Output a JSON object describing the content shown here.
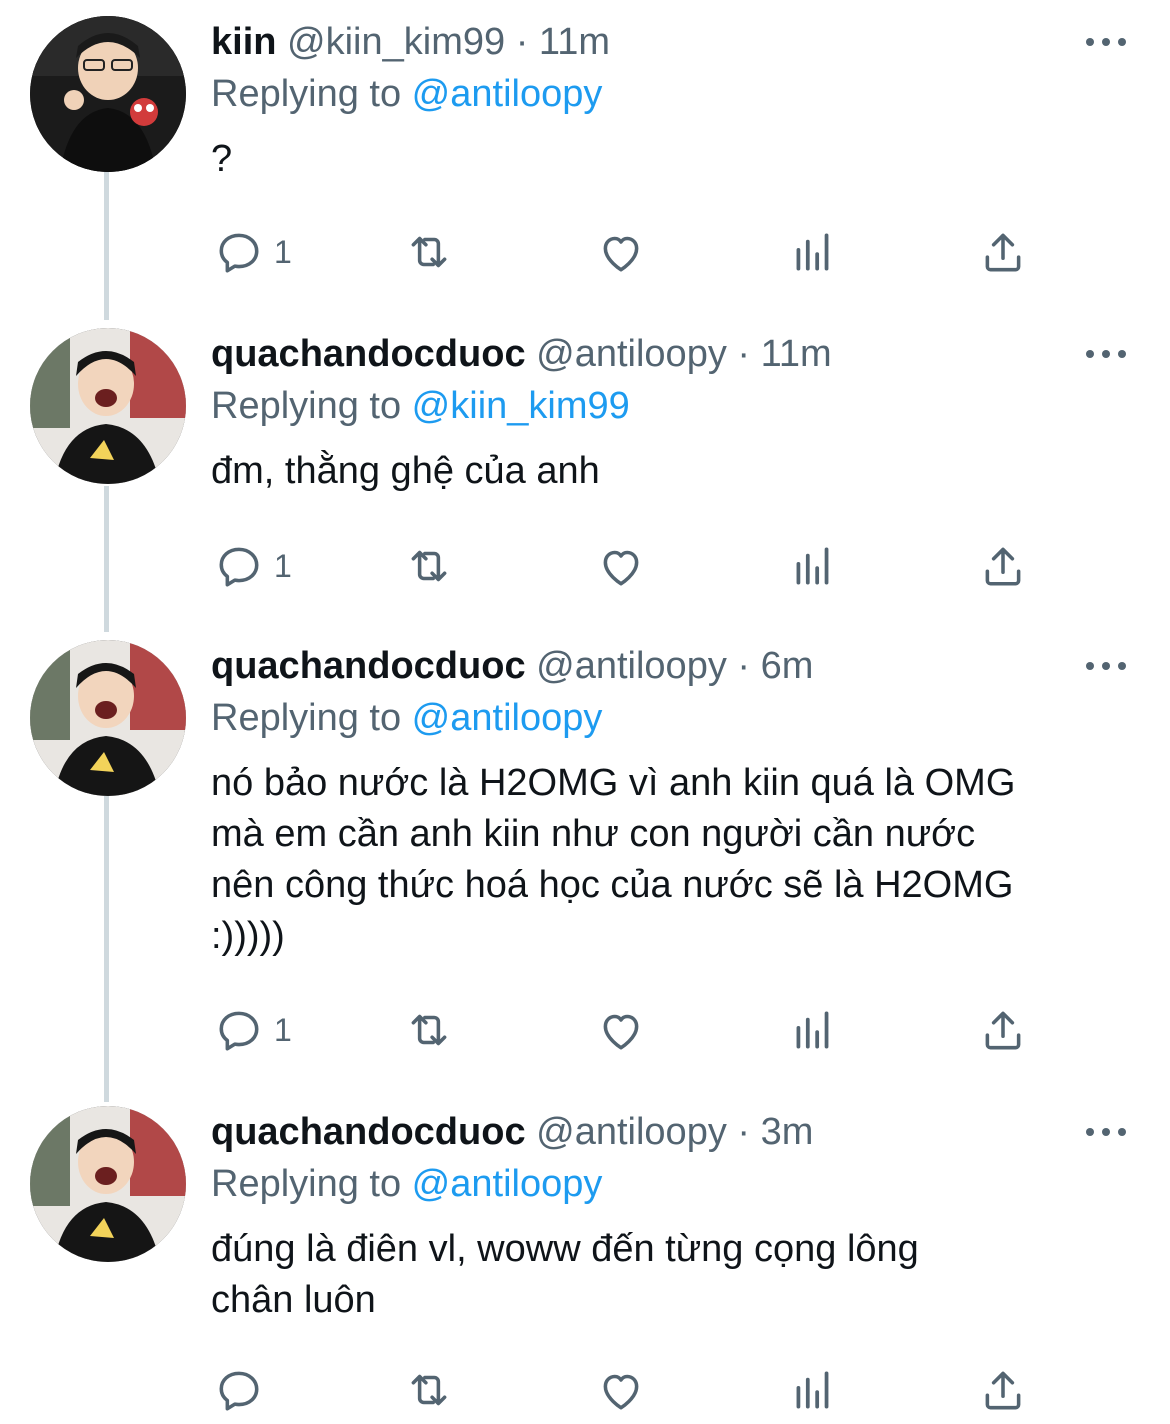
{
  "tweets": [
    {
      "name": "kiin",
      "handle": "@kiin_kim99",
      "separator": "·",
      "time": "11m",
      "replying_prefix": "Replying to ",
      "replying_to": "@antiloopy",
      "text": "?",
      "reply_count": "1"
    },
    {
      "name": "quachandocduoc",
      "handle": "@antiloopy",
      "separator": "·",
      "time": "11m",
      "replying_prefix": "Replying to ",
      "replying_to": "@kiin_kim99",
      "text": "đm, thằng ghệ của anh",
      "reply_count": "1"
    },
    {
      "name": "quachandocduoc",
      "handle": "@antiloopy",
      "separator": "·",
      "time": "6m",
      "replying_prefix": "Replying to ",
      "replying_to": "@antiloopy",
      "text": "nó bảo nước là H2OMG vì anh kiin quá là OMG\nmà em cần anh kiin như con người cần nước\nnên công thức hoá học của nước sẽ là H2OMG\n:)))))",
      "reply_count": "1"
    },
    {
      "name": "quachandocduoc",
      "handle": "@antiloopy",
      "separator": "·",
      "time": "3m",
      "replying_prefix": "Replying to ",
      "replying_to": "@antiloopy",
      "text": "đúng là điên vl, woww đến từng cọng lông\nchân luôn",
      "reply_count": ""
    }
  ],
  "icons": {
    "reply": "reply-icon",
    "retweet": "retweet-icon",
    "like": "like-icon",
    "views": "views-icon",
    "share": "share-icon",
    "more": "more-icon"
  },
  "colors": {
    "text": "#0f1419",
    "secondary": "#536471",
    "mention": "#1d9bf0",
    "thread_line": "#cfd9de"
  }
}
